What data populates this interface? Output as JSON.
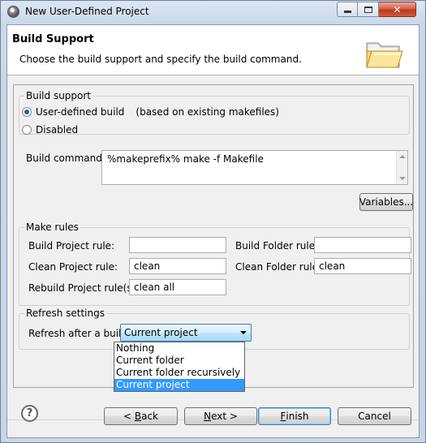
{
  "window": {
    "title": "New User-Defined Project",
    "close_glyph": "✕"
  },
  "header": {
    "title": "Build Support",
    "description": "Choose the build support and specify the build command."
  },
  "build_support": {
    "legend": "Build support",
    "options": [
      {
        "label": "User-defined build",
        "note": "(based on existing makefiles)",
        "selected": true
      },
      {
        "label": "Disabled",
        "selected": false
      }
    ]
  },
  "build_command": {
    "label": "Build command:",
    "value": "%makeprefix% make -f Makefile",
    "variables_button": "Variables..."
  },
  "make_rules": {
    "legend": "Make rules",
    "build_project": {
      "label": "Build Project rule:",
      "value": ""
    },
    "build_folder": {
      "label": "Build Folder rule:",
      "value": ""
    },
    "clean_project": {
      "label": "Clean Project rule:",
      "value": "clean"
    },
    "clean_folder": {
      "label": "Clean Folder rule:",
      "value": "clean"
    },
    "rebuild_project": {
      "label": "Rebuild Project rule(s):",
      "value": "clean all"
    }
  },
  "refresh_settings": {
    "legend": "Refresh settings",
    "label": "Refresh after a build:",
    "selected": "Current project",
    "options": [
      "Nothing",
      "Current folder",
      "Current folder recursively",
      "Current project"
    ]
  },
  "footer": {
    "help_glyph": "?",
    "back": {
      "prefix": "< ",
      "mnemonic": "B",
      "rest": "ack"
    },
    "next": {
      "mnemonic": "N",
      "rest": "ext >"
    },
    "finish": {
      "mnemonic": "F",
      "rest": "inish"
    },
    "cancel": "Cancel"
  }
}
